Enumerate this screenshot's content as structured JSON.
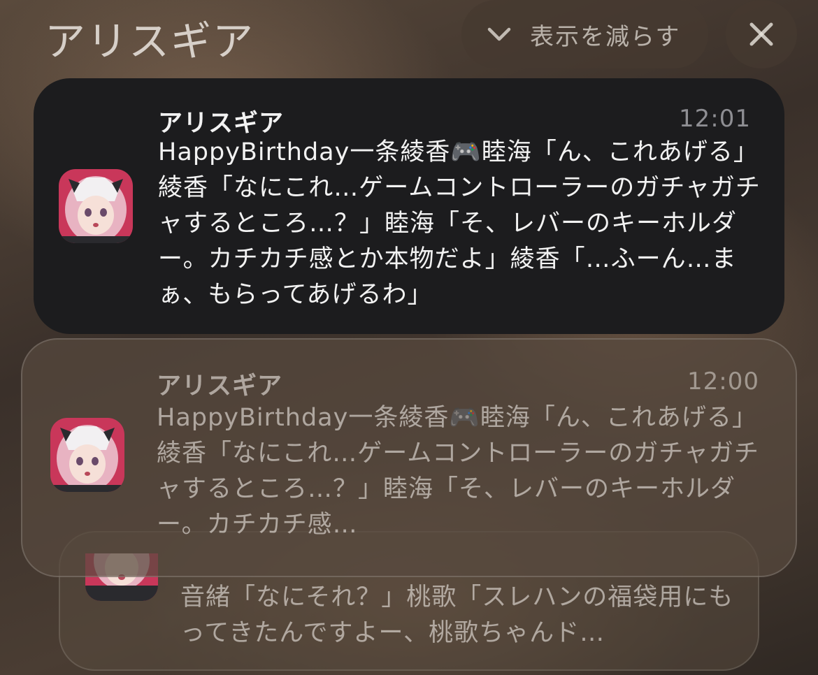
{
  "group": {
    "title": "アリスギア",
    "show_less_label": "表示を減らす",
    "chevron_icon": "chevron-down-icon",
    "close_icon": "close-icon"
  },
  "notifications": [
    {
      "app_name": "アリスギア",
      "time": "12:01",
      "icon": "app-icon-alice-gear",
      "body": "HappyBirthday一条綾香🎮睦海「ん、これあげる」綾香「なにこれ…ゲームコントローラーのガチャガチャするところ…？」睦海「そ、レバーのキーホルダー。カチカチ感とか本物だよ」綾香「…ふーん…まぁ、もらってあげるわ」"
    },
    {
      "app_name": "アリスギア",
      "time": "12:00",
      "icon": "app-icon-alice-gear",
      "body": "HappyBirthday一条綾香🎮睦海「ん、これあげる」綾香「なにこれ…ゲームコントローラーのガチャガチャするところ…？」睦海「そ、レバーのキーホルダー。カチカチ感…"
    },
    {
      "icon": "app-icon-alice-gear",
      "body": "音緒「なにそれ？」桃歌「スレハンの福袋用にもってきたんですよー、桃歌ちゃんド…"
    }
  ],
  "colors": {
    "card_dark": "#1c1c1e",
    "text_primary": "#f2f2f2",
    "text_secondary": "#8e8e93"
  }
}
